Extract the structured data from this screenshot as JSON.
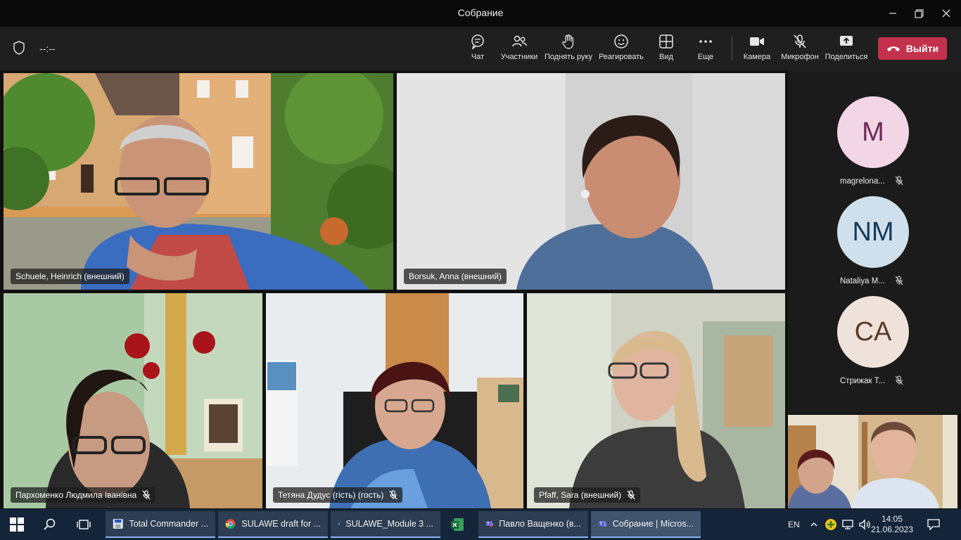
{
  "window": {
    "title": "Собрание"
  },
  "toolbar": {
    "timer": "--:--",
    "buttons": {
      "chat": "Чат",
      "participants": "Участники",
      "raise_hand": "Поднять руку",
      "react": "Реагировать",
      "view": "Вид",
      "more": "Еще",
      "camera": "Камера",
      "mic": "Микрофон",
      "share": "Поделиться"
    },
    "leave": "Выйти"
  },
  "tiles": [
    {
      "name": "Schuele, Heinrich (внешний)",
      "muted": false
    },
    {
      "name": "Borsuk, Anna (внешний)",
      "muted": false
    },
    {
      "name": "Пархоменко Людмила Іванівна",
      "muted": true
    },
    {
      "name": "Тетяна Дудус (гість) (гость)",
      "muted": true
    },
    {
      "name": "Pfaff, Sara (внешний)",
      "muted": true
    }
  ],
  "roster": [
    {
      "initials": "M",
      "name": "magrelona...",
      "bg": "#f2d6e6",
      "fg": "#6b2a55"
    },
    {
      "initials": "NM",
      "name": "Nataliya M...",
      "bg": "#cfe0ec",
      "fg": "#153a5a"
    },
    {
      "initials": "CA",
      "name": "Стрижак Т...",
      "bg": "#efe2da",
      "fg": "#5a3a28"
    }
  ],
  "taskbar": {
    "items": [
      {
        "label": "Total Commander ..."
      },
      {
        "label": "SULAWE draft for ..."
      },
      {
        "label": "SULAWE_Module 3 ..."
      },
      {
        "label": "Павло Ващенко (в..."
      },
      {
        "label": "Собрание | Micros..."
      }
    ],
    "lang": "EN",
    "time": "14:05",
    "date": "21.06.2023"
  },
  "colors": {
    "accent": "#c4314b",
    "taskbar": "#14253a",
    "toolbar": "#1f1f1f"
  }
}
